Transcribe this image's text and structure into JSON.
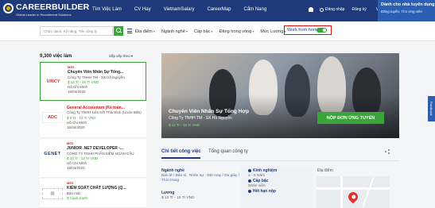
{
  "brand": {
    "name": "CAREERBUILDER",
    "tagline": "Global Leader in Recruitment Solutions"
  },
  "nav": {
    "items": [
      "Tìm Việc Làm",
      "CV Hay",
      "VietnamSalary",
      "CareerMap",
      "Cẩm Nang"
    ],
    "login": "Đăng nhập",
    "register": "Đăng ký",
    "language": "Vi"
  },
  "employer": {
    "title": "Dành cho nhà tuyển dụng",
    "subtitle": "Đăng tuyển, Tìm ứng viên"
  },
  "search": {
    "placeholder": "Chức danh, Kỹ năng, Tên công ty",
    "filters": [
      "Địa điểm",
      "Ngành nghề",
      "Cấp bậc",
      "Đăng trong vòng",
      "Mức Lương"
    ],
    "wfh_label": "Work from home",
    "wfh_on": true
  },
  "results": {
    "count": "9,300 việc làm",
    "sort": "Sắp xếp theo"
  },
  "jobs": [
    {
      "logo": "VINCY",
      "logo_color": "#e03030",
      "badge": "MỚI",
      "title": "Chuyên Viên Nhân Sự Tổng...",
      "company": "Công Ty TNHH TM - SX Hồ Nguyễn",
      "salary": "$ 12 Tr - 15 Tr VND",
      "location": "Hồ Chí Minh",
      "date": "16/04/2020"
    },
    {
      "logo": "ADC",
      "logo_color": "#c0302a",
      "badge": "",
      "title": "General Accountant (Kế toán...",
      "company": "Công Ty TNHH Liên Kết Thái Bình (Uncle Bills)",
      "salary": "$ 8 Tr - 12 Tr VND",
      "location": "Hồ Chí Minh",
      "date": "16/04/2020"
    },
    {
      "logo": "GENET",
      "logo_color": "#1f3a7a",
      "badge": "MỚI",
      "title": "JUNIOR .NET DEVELOPER -...",
      "company": "CÔNG TY TNHH PHẦN MỀM HOÀN CẦU",
      "salary": "$ 10 Tr - 12 Tr VND",
      "location": "Hồ Chí Minh",
      "date": "16/04/2020"
    },
    {
      "logo": "",
      "logo_color": "#bbbbbb",
      "badge": "MỚI",
      "title": "KIỂM SOÁT CHẤT LƯỢNG (Q...",
      "company": "Bảo mật",
      "salary": "$ Cạnh tranh",
      "location": "",
      "date": ""
    }
  ],
  "hero": {
    "title": "Chuyên Viên Nhân Sự Tổng Hợp",
    "company": "Công Ty TNHH TM - SX Hồ Nguyễn",
    "salary": "$ 12 Tr - 15 Tr VND",
    "apply": "NỘP ĐƠN ỨNG TUYỂN"
  },
  "tabs": {
    "details": "Chi tiết công việc",
    "company": "Tổng quan công ty"
  },
  "detail": {
    "industry_label": "Ngành nghề",
    "industry_1": "Bán lẻ / Bán sỉ , Nhân sự , Dệt may / Da giày /",
    "industry_2": "Thời trang",
    "salary_label": "Lương",
    "salary": "$ 12 Tr - 15 Tr VND",
    "experience_label": "Kinh nghiệm",
    "experience": "2 - 5 Năm",
    "level_label": "Cấp bậc",
    "level": "Nhân viên",
    "deadline_label": "Hết hạn nộp",
    "location_label": "Địa điểm"
  },
  "feedback": "Feedback"
}
